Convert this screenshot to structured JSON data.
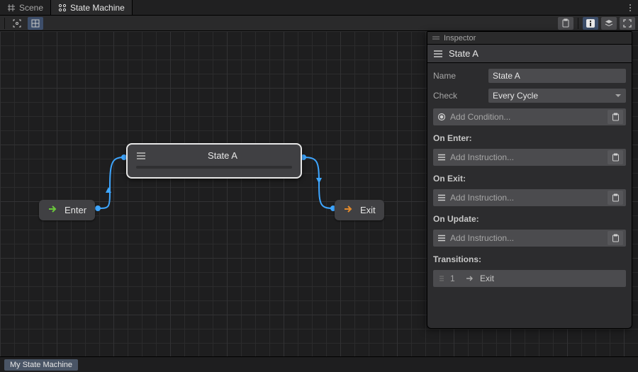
{
  "tabs": {
    "scene": "Scene",
    "state_machine": "State Machine"
  },
  "inspector_tab": "Inspector",
  "state": {
    "title": "State A",
    "name_label": "Name",
    "name_value": "State A",
    "check_label": "Check",
    "check_value": "Every Cycle",
    "add_condition": "Add Condition...",
    "on_enter_label": "On Enter:",
    "on_exit_label": "On Exit:",
    "on_update_label": "On Update:",
    "add_instruction": "Add Instruction...",
    "transitions_label": "Transitions:",
    "transition": {
      "index": "1",
      "target": "Exit"
    }
  },
  "nodes": {
    "enter": "Enter",
    "exit": "Exit",
    "state_a": "State A"
  },
  "footer": {
    "label": "My State Machine"
  },
  "colors": {
    "link": "#3ea6ff",
    "enter_arrow": "#6ac93b",
    "exit_arrow": "#e38a2c"
  }
}
